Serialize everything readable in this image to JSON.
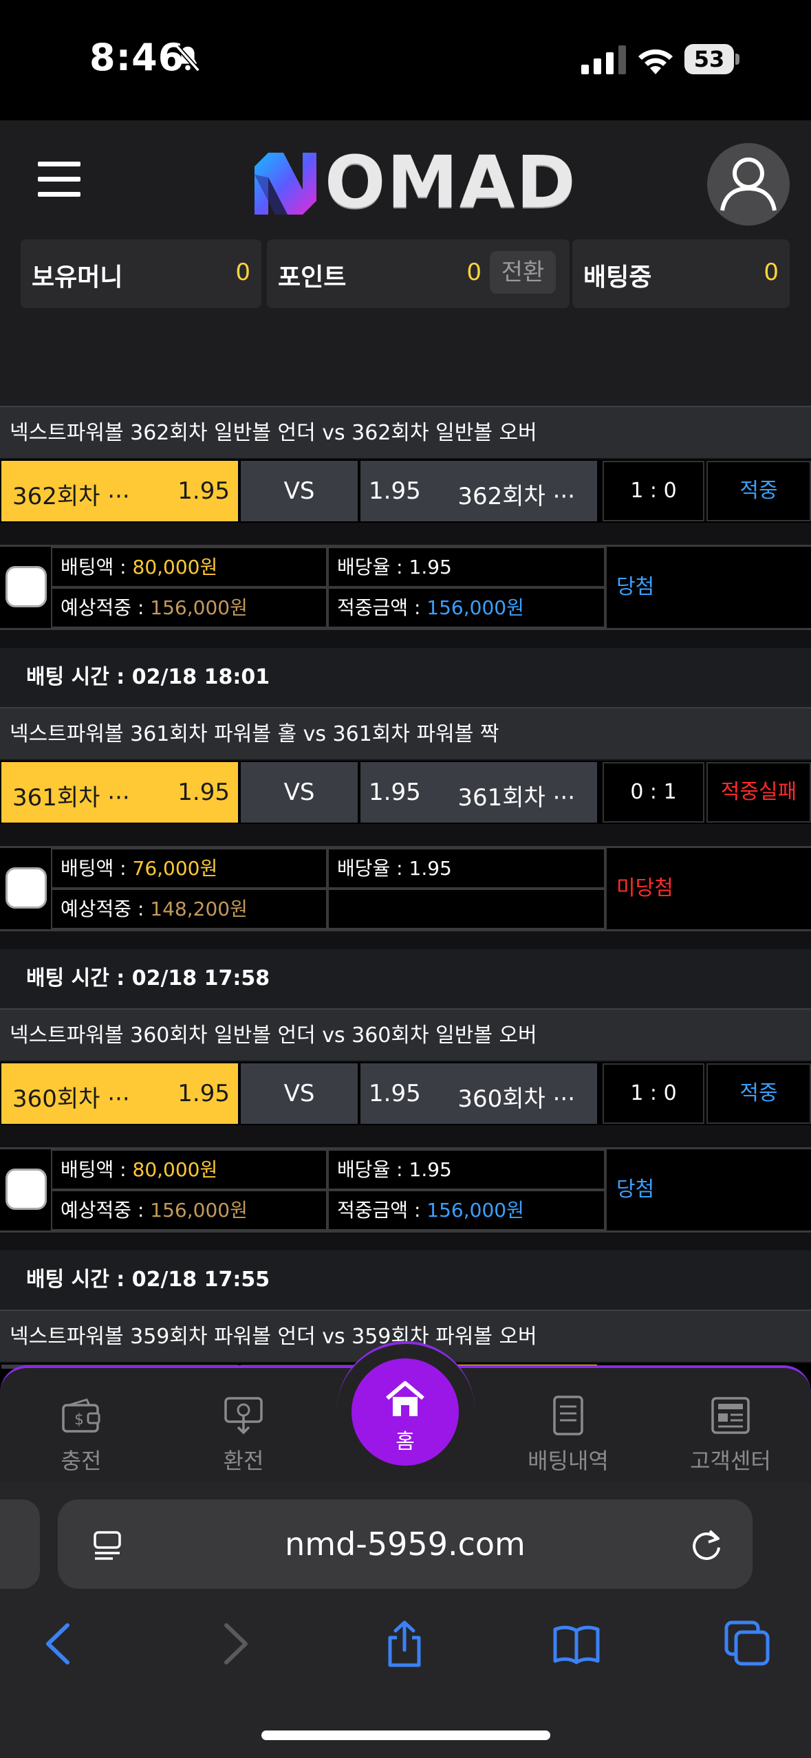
{
  "status_bar": {
    "time": "8:46",
    "battery": "53"
  },
  "header": {
    "logo_text": "OMAD",
    "wallet": [
      {
        "label": "보유머니",
        "value": "0"
      },
      {
        "label": "포인트",
        "value": "0"
      },
      {
        "label": "배팅중",
        "value": "0"
      }
    ],
    "convert_label": "전환"
  },
  "bets": [
    {
      "title": "넥스트파워볼 362회차 일반볼 언더  vs  362회차 일반볼 오버",
      "home_name": "362회차 ···",
      "home_odds": "1.95",
      "vs": "VS",
      "away_odds": "1.95",
      "away_name": "362회차 ···",
      "score": "1 : 0",
      "result": "적중",
      "result_color": "#3ba0ff",
      "bet_amount_label": "배팅액 : ",
      "bet_amount": "80,000원",
      "odds_label": "배당율 : ",
      "odds": "1.95",
      "expected_label": "예상적중 : ",
      "expected": "156,000원",
      "win_label": "적중금액 : ",
      "win_amount": "156,000원",
      "status": "당첨",
      "status_color": "#3ba0ff",
      "time": "배팅 시간 : 02/18 18:01"
    },
    {
      "title": "넥스트파워볼 361회차 파워볼 홀  vs  361회차 파워볼 짝",
      "home_name": "361회차 ···",
      "home_odds": "1.95",
      "vs": "VS",
      "away_odds": "1.95",
      "away_name": "361회차 ···",
      "score": "0 : 1",
      "result": "적중실패",
      "result_color": "#ff2b2b",
      "bet_amount_label": "배팅액 : ",
      "bet_amount": "76,000원",
      "odds_label": "배당율 : ",
      "odds": "1.95",
      "expected_label": "예상적중 : ",
      "expected": "148,200원",
      "win_label": "",
      "win_amount": "",
      "status": "미당첨",
      "status_color": "#ff2b2b",
      "time": "배팅 시간 : 02/18 17:58"
    },
    {
      "title": "넥스트파워볼 360회차 일반볼 언더  vs  360회차 일반볼 오버",
      "home_name": "360회차 ···",
      "home_odds": "1.95",
      "vs": "VS",
      "away_odds": "1.95",
      "away_name": "360회차 ···",
      "score": "1 : 0",
      "result": "적중",
      "result_color": "#3ba0ff",
      "bet_amount_label": "배팅액 : ",
      "bet_amount": "80,000원",
      "odds_label": "배당율 : ",
      "odds": "1.95",
      "expected_label": "예상적중 : ",
      "expected": "156,000원",
      "win_label": "적중금액 : ",
      "win_amount": "156,000원",
      "status": "당첨",
      "status_color": "#3ba0ff",
      "time": "배팅 시간 : 02/18 17:55"
    },
    {
      "title": "넥스트파워볼 359회차 파워볼 언더  vs  359회차 파워볼 오버"
    }
  ],
  "bottom_nav": {
    "items": [
      {
        "label": "충전",
        "icon": "wallet-icon"
      },
      {
        "label": "환전",
        "icon": "exchange-icon"
      },
      {
        "label": "홈",
        "icon": "home-icon"
      },
      {
        "label": "배팅내역",
        "icon": "document-icon"
      },
      {
        "label": "고객센터",
        "icon": "newspaper-icon"
      }
    ]
  },
  "browser": {
    "url": "nmd-5959.com"
  }
}
